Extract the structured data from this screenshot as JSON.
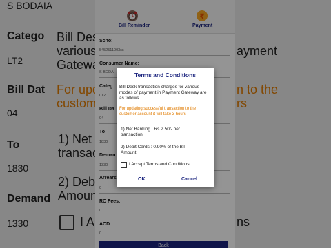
{
  "background": {
    "left": {
      "name_partial": "S BODAIA",
      "category_label": "Catego",
      "category_value": "LT2",
      "bill_date_label": "Bill Dat",
      "bill_date_value": "04",
      "total_label": "To",
      "total_value": "1830",
      "demand_label": "Demand",
      "demand_value": "1330"
    },
    "right": {
      "line1": "Bill Desk",
      "line2": "various",
      "line3": "Gateway",
      "right_partial1": "ayment",
      "orange1": "For updat",
      "orange2": "customer",
      "orange_right1": "n to the",
      "orange_right2": "rs",
      "net_partial": "1) Net",
      "transac_partial": "transac",
      "debit_partial": "2) Debi",
      "amount_partial": "Amount",
      "accept_partial": "I A",
      "accept_right": "ns"
    }
  },
  "topbar": {
    "bill_reminder": "Bill Reminder",
    "payment": "Payment"
  },
  "form": {
    "scno_label": "Scno:",
    "scno_value": "5452511003ss",
    "consumer_label": "Consumer Name:",
    "consumer_value": "S BODAI",
    "category_label": "Categ",
    "category_value": "LT2",
    "billdate_label": "Bill Da",
    "billdate_value": "04",
    "total_label": "To",
    "total_value": "1830",
    "demand_label": "Deman",
    "demand_value": "1330",
    "arrears_label": "Arrears:",
    "arrears_value": "0",
    "rc_label": "RC Fees:",
    "rc_value": "0",
    "acd_label": "ACD:",
    "acd_value": "0",
    "back_button": "Back"
  },
  "modal": {
    "title": "Terms and Conditions",
    "intro": "Bill Desk transaction charges for various modes of payment in Payment Gateway are as follows",
    "warning": "For updating successful transaction to the customer account it will take 3 hours",
    "item1": "1) Net Banking : Rs.2.50/- per transaction",
    "item2": "2) Debit Cards : 0.90% of the Bill Amount",
    "checkbox_label": "I Accept Terms and Conditions",
    "ok_button": "OK",
    "cancel_button": "Cancel"
  },
  "colors": {
    "accent": "#1a237e",
    "warning": "#e07b00",
    "overlay": "#00000066"
  }
}
